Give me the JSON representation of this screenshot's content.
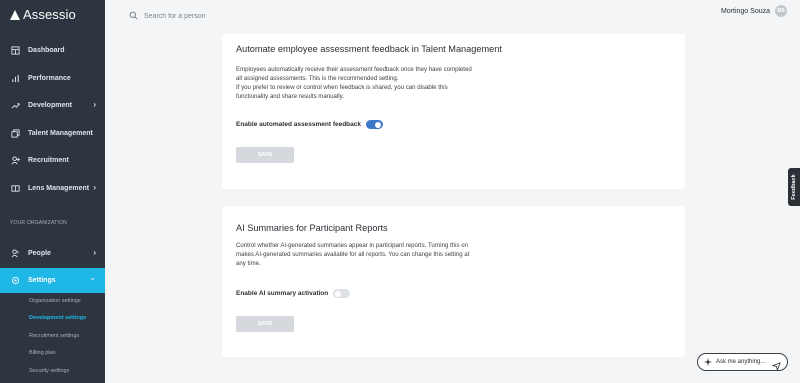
{
  "brand": {
    "name": "Assessio"
  },
  "search": {
    "placeholder": "Search for a person"
  },
  "user": {
    "name": "Mortingo Souza",
    "initials": "MS"
  },
  "sidebar": {
    "items": [
      {
        "label": "Dashboard",
        "icon": "dashboard-icon"
      },
      {
        "label": "Performance",
        "icon": "bar-chart-icon"
      },
      {
        "label": "Development",
        "icon": "trend-up-icon",
        "chevron": "›"
      },
      {
        "label": "Talent Management",
        "icon": "copy-icon"
      },
      {
        "label": "Recruitment",
        "icon": "person-add-icon"
      },
      {
        "label": "Lens Management",
        "icon": "book-icon",
        "chevron": "›"
      }
    ],
    "section_label": "YOUR ORGANIZATION",
    "org_items": [
      {
        "label": "People",
        "icon": "people-icon",
        "chevron": "›"
      },
      {
        "label": "Settings",
        "icon": "gear-icon",
        "chevron": "⌄",
        "active": true
      }
    ],
    "sub_items": [
      {
        "label": "Organization settings"
      },
      {
        "label": "Development settings",
        "active": true
      },
      {
        "label": "Recruitment settings"
      },
      {
        "label": "Billing plan"
      },
      {
        "label": "Security settings"
      }
    ]
  },
  "cards": [
    {
      "title": "Automate employee assessment feedback in Talent Management",
      "description_lines": [
        "Employees automatically receive their assessment feedback once they have completed",
        "all assigned assessments. This is the recommended setting.",
        "If you prefer to review or control when feedback is shared, you can disable this",
        "functionality and share results manually."
      ],
      "toggle_label": "Enable automated assessment feedback",
      "toggle_on": true,
      "save_label": "SAVE"
    },
    {
      "title": "AI Summaries for Participant Reports",
      "description_lines": [
        "Control whether AI-generated summaries appear in participant reports. Turning this on",
        "makes AI-generated summaries available for all reports. You can change this setting at",
        "any time."
      ],
      "toggle_label": "Enable AI summary activation",
      "toggle_on": false,
      "save_label": "SAVE"
    }
  ],
  "feedback_tab": {
    "label": "Feedback"
  },
  "ask": {
    "label": "Ask me anything..."
  },
  "colors": {
    "sidebar": "#2d3640",
    "accent": "#1fb7e6",
    "toggle_on": "#3e77c9"
  }
}
